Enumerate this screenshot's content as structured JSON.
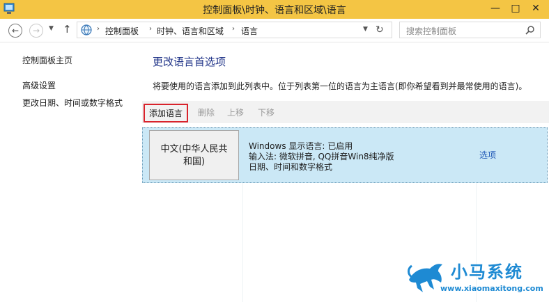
{
  "window": {
    "title": "控制面板\\时钟、语言和区域\\语言",
    "minimize": "—",
    "maximize": "□",
    "close": "✕"
  },
  "address": {
    "crumbs": [
      "控制面板",
      "时钟、语言和区域",
      "语言"
    ],
    "search_placeholder": "搜索控制面板"
  },
  "sidebar": {
    "items": [
      {
        "label": "控制面板主页"
      },
      {
        "label": "高级设置"
      },
      {
        "label": "更改日期、时间或数字格式"
      }
    ]
  },
  "main": {
    "heading": "更改语言首选项",
    "description": "将要使用的语言添加到此列表中。位于列表第一位的语言为主语言(即你希望看到并最常使用的语言)。",
    "toolbar": {
      "add": "添加语言",
      "remove": "删除",
      "up": "上移",
      "down": "下移"
    },
    "languages": [
      {
        "name_line1": "中文(中华人民共",
        "name_line2": "和国)",
        "display": "Windows 显示语言: 已启用",
        "input": "输入法: 微软拼音, QQ拼音Win8纯净版",
        "format": "日期、时间和数字格式",
        "options": "选项"
      }
    ]
  },
  "watermark": {
    "name": "小马系统",
    "url": "www.xiaomaxitong.com"
  },
  "colors": {
    "titlebar": "#f4c544",
    "selected_row": "#cbe8f6",
    "link": "#1e56b5",
    "heading": "#1e3287",
    "highlight_border": "#d9232c"
  }
}
